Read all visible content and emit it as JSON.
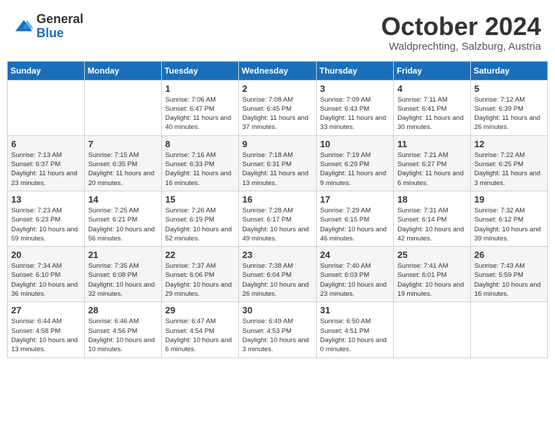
{
  "header": {
    "logo_general": "General",
    "logo_blue": "Blue",
    "month_title": "October 2024",
    "subtitle": "Waldprechting, Salzburg, Austria"
  },
  "days_of_week": [
    "Sunday",
    "Monday",
    "Tuesday",
    "Wednesday",
    "Thursday",
    "Friday",
    "Saturday"
  ],
  "weeks": [
    [
      {
        "day": "",
        "info": ""
      },
      {
        "day": "",
        "info": ""
      },
      {
        "day": "1",
        "info": "Sunrise: 7:06 AM\nSunset: 6:47 PM\nDaylight: 11 hours and 40 minutes."
      },
      {
        "day": "2",
        "info": "Sunrise: 7:08 AM\nSunset: 6:45 PM\nDaylight: 11 hours and 37 minutes."
      },
      {
        "day": "3",
        "info": "Sunrise: 7:09 AM\nSunset: 6:43 PM\nDaylight: 11 hours and 33 minutes."
      },
      {
        "day": "4",
        "info": "Sunrise: 7:11 AM\nSunset: 6:41 PM\nDaylight: 11 hours and 30 minutes."
      },
      {
        "day": "5",
        "info": "Sunrise: 7:12 AM\nSunset: 6:39 PM\nDaylight: 11 hours and 26 minutes."
      }
    ],
    [
      {
        "day": "6",
        "info": "Sunrise: 7:13 AM\nSunset: 6:37 PM\nDaylight: 11 hours and 23 minutes."
      },
      {
        "day": "7",
        "info": "Sunrise: 7:15 AM\nSunset: 6:35 PM\nDaylight: 11 hours and 20 minutes."
      },
      {
        "day": "8",
        "info": "Sunrise: 7:16 AM\nSunset: 6:33 PM\nDaylight: 11 hours and 16 minutes."
      },
      {
        "day": "9",
        "info": "Sunrise: 7:18 AM\nSunset: 6:31 PM\nDaylight: 11 hours and 13 minutes."
      },
      {
        "day": "10",
        "info": "Sunrise: 7:19 AM\nSunset: 6:29 PM\nDaylight: 11 hours and 9 minutes."
      },
      {
        "day": "11",
        "info": "Sunrise: 7:21 AM\nSunset: 6:27 PM\nDaylight: 11 hours and 6 minutes."
      },
      {
        "day": "12",
        "info": "Sunrise: 7:22 AM\nSunset: 6:25 PM\nDaylight: 11 hours and 3 minutes."
      }
    ],
    [
      {
        "day": "13",
        "info": "Sunrise: 7:23 AM\nSunset: 6:23 PM\nDaylight: 10 hours and 59 minutes."
      },
      {
        "day": "14",
        "info": "Sunrise: 7:25 AM\nSunset: 6:21 PM\nDaylight: 10 hours and 56 minutes."
      },
      {
        "day": "15",
        "info": "Sunrise: 7:26 AM\nSunset: 6:19 PM\nDaylight: 10 hours and 52 minutes."
      },
      {
        "day": "16",
        "info": "Sunrise: 7:28 AM\nSunset: 6:17 PM\nDaylight: 10 hours and 49 minutes."
      },
      {
        "day": "17",
        "info": "Sunrise: 7:29 AM\nSunset: 6:15 PM\nDaylight: 10 hours and 46 minutes."
      },
      {
        "day": "18",
        "info": "Sunrise: 7:31 AM\nSunset: 6:14 PM\nDaylight: 10 hours and 42 minutes."
      },
      {
        "day": "19",
        "info": "Sunrise: 7:32 AM\nSunset: 6:12 PM\nDaylight: 10 hours and 39 minutes."
      }
    ],
    [
      {
        "day": "20",
        "info": "Sunrise: 7:34 AM\nSunset: 6:10 PM\nDaylight: 10 hours and 36 minutes."
      },
      {
        "day": "21",
        "info": "Sunrise: 7:35 AM\nSunset: 6:08 PM\nDaylight: 10 hours and 32 minutes."
      },
      {
        "day": "22",
        "info": "Sunrise: 7:37 AM\nSunset: 6:06 PM\nDaylight: 10 hours and 29 minutes."
      },
      {
        "day": "23",
        "info": "Sunrise: 7:38 AM\nSunset: 6:04 PM\nDaylight: 10 hours and 26 minutes."
      },
      {
        "day": "24",
        "info": "Sunrise: 7:40 AM\nSunset: 6:03 PM\nDaylight: 10 hours and 23 minutes."
      },
      {
        "day": "25",
        "info": "Sunrise: 7:41 AM\nSunset: 6:01 PM\nDaylight: 10 hours and 19 minutes."
      },
      {
        "day": "26",
        "info": "Sunrise: 7:43 AM\nSunset: 5:59 PM\nDaylight: 10 hours and 16 minutes."
      }
    ],
    [
      {
        "day": "27",
        "info": "Sunrise: 6:44 AM\nSunset: 4:58 PM\nDaylight: 10 hours and 13 minutes."
      },
      {
        "day": "28",
        "info": "Sunrise: 6:46 AM\nSunset: 4:56 PM\nDaylight: 10 hours and 10 minutes."
      },
      {
        "day": "29",
        "info": "Sunrise: 6:47 AM\nSunset: 4:54 PM\nDaylight: 10 hours and 6 minutes."
      },
      {
        "day": "30",
        "info": "Sunrise: 6:49 AM\nSunset: 4:53 PM\nDaylight: 10 hours and 3 minutes."
      },
      {
        "day": "31",
        "info": "Sunrise: 6:50 AM\nSunset: 4:51 PM\nDaylight: 10 hours and 0 minutes."
      },
      {
        "day": "",
        "info": ""
      },
      {
        "day": "",
        "info": ""
      }
    ]
  ]
}
